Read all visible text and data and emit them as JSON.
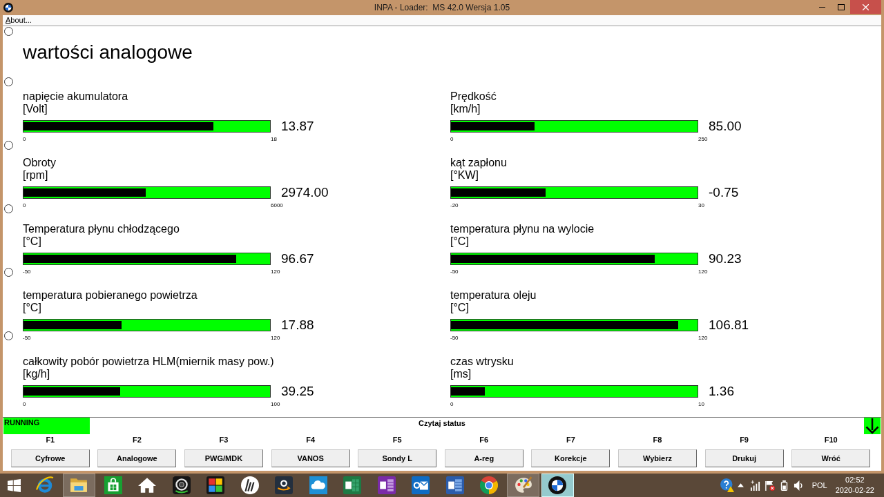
{
  "window": {
    "title": "INPA - Loader:  MS 42.0 Wersja 1.05"
  },
  "menu": [
    {
      "label": "About..."
    }
  ],
  "screen": {
    "title": "wartości analogowe",
    "selectors": [
      {
        "selected": false
      },
      {
        "selected": false
      },
      {
        "selected": false
      },
      {
        "selected": false
      },
      {
        "selected": false
      },
      {
        "selected": false
      }
    ],
    "gauges": [
      {
        "label": "napięcie akumulatora",
        "unit": "[Volt]",
        "value": "13.87",
        "min": "0",
        "max": "18",
        "level": 0.771
      },
      {
        "label": "Prędkość",
        "unit": "[km/h]",
        "value": "85.00",
        "min": "0",
        "max": "250",
        "level": 0.34
      },
      {
        "label": "Obroty",
        "unit": "[rpm]",
        "value": "2974.00",
        "min": "0",
        "max": "6000",
        "level": 0.496
      },
      {
        "label": "kąt zapłonu",
        "unit": "[°KW]",
        "value": "-0.75",
        "min": "-20",
        "max": "30",
        "level": 0.385
      },
      {
        "label": "Temperatura płynu chłodzącego",
        "unit": "[°C]",
        "value": "96.67",
        "min": "-50",
        "max": "120",
        "level": 0.863
      },
      {
        "label": "temperatura płynu na wylocie",
        "unit": "[°C]",
        "value": "90.23",
        "min": "-50",
        "max": "120",
        "level": 0.825
      },
      {
        "label": "temperatura pobieranego powietrza",
        "unit": "[°C]",
        "value": "17.88",
        "min": "-50",
        "max": "120",
        "level": 0.399
      },
      {
        "label": "temperatura oleju",
        "unit": "[°C]",
        "value": "106.81",
        "min": "-50",
        "max": "120",
        "level": 0.922
      },
      {
        "label": "całkowity pobór powietrza HLM(miernik masy pow.)",
        "unit": "[kg/h]",
        "value": "39.25",
        "min": "0",
        "max": "100",
        "level": 0.393
      },
      {
        "label": "czas wtrysku",
        "unit": "[ms]",
        "value": "1.36",
        "min": "0",
        "max": "10",
        "level": 0.136
      }
    ]
  },
  "status": {
    "state": "RUNNING",
    "message": "Czytaj status"
  },
  "function_keys": [
    {
      "key": "F1",
      "label": "Cyfrowe"
    },
    {
      "key": "F2",
      "label": "Analogowe"
    },
    {
      "key": "F3",
      "label": "PWG/MDK"
    },
    {
      "key": "F4",
      "label": "VANOS"
    },
    {
      "key": "F5",
      "label": "Sondy L"
    },
    {
      "key": "F6",
      "label": "A-reg"
    },
    {
      "key": "F7",
      "label": "Korekcje"
    },
    {
      "key": "F8",
      "label": "Wybierz"
    },
    {
      "key": "F9",
      "label": "Drukuj"
    },
    {
      "key": "F10",
      "label": "Wróć"
    }
  ],
  "taskbar": {
    "apps": [
      {
        "running": false,
        "selected": false
      },
      {
        "running": true,
        "selected": false
      },
      {
        "running": false,
        "selected": false
      },
      {
        "running": false,
        "selected": false
      },
      {
        "running": false,
        "selected": false
      },
      {
        "running": false,
        "selected": false
      },
      {
        "running": false,
        "selected": false
      },
      {
        "running": false,
        "selected": false
      },
      {
        "running": false,
        "selected": false
      },
      {
        "running": false,
        "selected": false
      },
      {
        "running": false,
        "selected": false
      },
      {
        "running": false,
        "selected": false
      },
      {
        "running": false,
        "selected": false
      },
      {
        "running": false,
        "selected": false
      },
      {
        "running": true,
        "selected": false
      },
      {
        "running": true,
        "selected": true
      }
    ],
    "tray": {
      "language": "POL",
      "time": "02:52",
      "date": "2020-02-22"
    }
  }
}
